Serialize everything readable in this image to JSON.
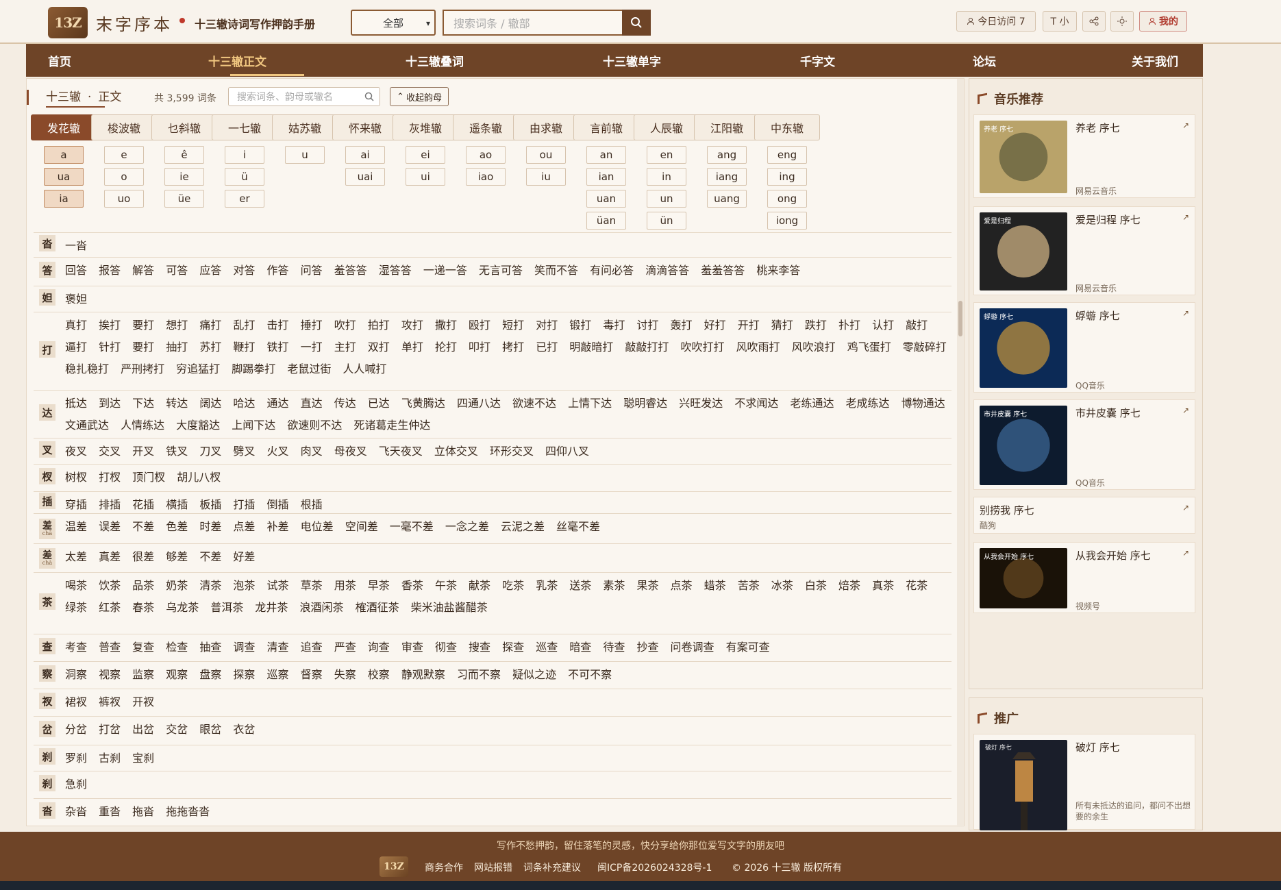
{
  "header": {
    "logo_text": "13Z",
    "brand": "末字序本",
    "tagline": "十三辙诗词写作押韵手册",
    "select_value": "全部",
    "search_placeholder": "搜索词条 / 辙部",
    "visits_label": "今日访问 7",
    "font_label": "T 小",
    "mine_label": "我的"
  },
  "nav": {
    "items": [
      "首页",
      "十三辙正文",
      "十三辙叠词",
      "十三辙单字",
      "千字文",
      "论坛",
      "关于我们"
    ],
    "active": "十三辙正文"
  },
  "content": {
    "tab_label": "十三辙",
    "tab_sep": "·",
    "tab_sub": "正文",
    "count_text": "共 3,599 词条",
    "search_placeholder": "搜索词条、韵母或辙名",
    "collapse_label": "收起韵母",
    "rhymes": [
      {
        "name": "发花辙",
        "finals": [
          "a",
          "ua",
          "ia"
        ]
      },
      {
        "name": "梭波辙",
        "finals": [
          "e",
          "o",
          "uo"
        ]
      },
      {
        "name": "乜斜辙",
        "finals": [
          "ê",
          "ie",
          "üe"
        ]
      },
      {
        "name": "一七辙",
        "finals": [
          "i",
          "ü",
          "er"
        ]
      },
      {
        "name": "姑苏辙",
        "finals": [
          "u"
        ]
      },
      {
        "name": "怀来辙",
        "finals": [
          "ai",
          "uai"
        ]
      },
      {
        "name": "灰堆辙",
        "finals": [
          "ei",
          "ui"
        ]
      },
      {
        "name": "遥条辙",
        "finals": [
          "ao",
          "iao"
        ]
      },
      {
        "name": "由求辙",
        "finals": [
          "ou",
          "iu"
        ]
      },
      {
        "name": "言前辙",
        "finals": [
          "an",
          "ian",
          "uan",
          "üan"
        ]
      },
      {
        "name": "人辰辙",
        "finals": [
          "en",
          "in",
          "un",
          "ün"
        ]
      },
      {
        "name": "江阳辙",
        "finals": [
          "ang",
          "iang",
          "uang"
        ]
      },
      {
        "name": "中东辙",
        "finals": [
          "eng",
          "ing",
          "ong",
          "iong"
        ]
      }
    ],
    "entries": [
      {
        "char": "沓",
        "pinyin": "",
        "words": "一沓"
      },
      {
        "char": "答",
        "pinyin": "",
        "words": "回答 报答 解答 可答 应答 对答 作答 问答 羞答答 湿答答 一递一答 无言可答 笑而不答 有问必答 滴滴答答 羞羞答答 桃来李答"
      },
      {
        "char": "妲",
        "pinyin": "",
        "words": "褒妲"
      },
      {
        "char": "打",
        "pinyin": "",
        "words": "真打 挨打 要打 想打 痛打 乱打 击打 捶打 吹打 拍打 攻打 撒打 殴打 短打 对打 锻打 毒打 讨打 轰打 好打 开打 猜打 跌打 扑打 认打 敲打 逼打 针打 要打 抽打 苏打 鞭打 铁打 一打 主打 双打 单打 抡打 叩打 拷打 已打 明敲暗打 敲敲打打 吹吹打打 风吹雨打 风吹浪打 鸡飞蛋打 零敲碎打 稳扎稳打 严刑拷打 穷追猛打 脚踢拳打 老鼠过街 人人喊打"
      },
      {
        "char": "达",
        "pinyin": "",
        "words": "抵达 到达 下达 转达 阔达 哈达 通达 直达 传达 已达 飞黄腾达 四通八达 欲速不达 上情下达 聪明睿达 兴旺发达 不求闻达 老练通达 老成练达 博物通达 文通武达 人情练达 大度豁达 上闻下达 欲速则不达 死诸葛走生仲达"
      },
      {
        "char": "叉",
        "pinyin": "",
        "words": "夜叉 交叉 开叉 铁叉 刀叉 劈叉 火叉 肉叉 母夜叉 飞天夜叉 立体交叉 环形交叉 四仰八叉"
      },
      {
        "char": "杈",
        "pinyin": "",
        "words": "树杈 打杈 顶门杈 胡儿八杈"
      },
      {
        "char": "插",
        "pinyin": "",
        "words": "穿插 排插 花插 横插 板插 打插 倒插 根插"
      },
      {
        "char": "差",
        "pinyin": "chā",
        "words": "温差 误差 不差 色差 时差 点差 补差 电位差 空间差 一毫不差 一念之差 云泥之差 丝毫不差"
      },
      {
        "char": "差",
        "pinyin": "chà",
        "words": "太差 真差 很差 够差 不差 好差"
      },
      {
        "char": "茶",
        "pinyin": "",
        "words": "喝茶 饮茶 品茶 奶茶 清茶 泡茶 试茶 草茶 用茶 早茶 香茶 午茶 献茶 吃茶 乳茶 送茶 素茶 果茶 点茶 蜡茶 苦茶 冰茶 白茶 焙茶 真茶 花茶 绿茶 红茶 春茶 乌龙茶 普洱茶 龙井茶 浪酒闲茶 榷酒征茶 柴米油盐酱醋茶"
      },
      {
        "char": "查",
        "pinyin": "",
        "words": "考查 普查 复查 检查 抽查 调查 清查 追查 严查 询查 审查 彻查 搜查 探查 巡查 暗查 待查 抄查 问卷调查 有案可查"
      },
      {
        "char": "察",
        "pinyin": "",
        "words": "洞察 视察 监察 观察 盘察 探察 巡察 督察 失察 校察 静观默察 习而不察 疑似之迹 不可不察"
      },
      {
        "char": "衩",
        "pinyin": "",
        "words": "裙衩 裤衩 开衩"
      },
      {
        "char": "岔",
        "pinyin": "",
        "words": "分岔 打岔 出岔 交岔 眼岔 衣岔"
      },
      {
        "char": "刹",
        "pinyin": "",
        "words": "罗刹 古刹 宝刹"
      },
      {
        "char": "刹",
        "pinyin": "",
        "words": "急刹"
      },
      {
        "char": "沓",
        "pinyin": "",
        "words": "杂沓 重沓 拖沓 拖拖沓沓"
      }
    ]
  },
  "sidebar": {
    "music_title": "音乐推荐",
    "songs": [
      {
        "title": "养老 序七",
        "source": "网易云音乐",
        "art": "养老 序七"
      },
      {
        "title": "爱是归程 序七",
        "source": "网易云音乐",
        "art": "爱是归程"
      },
      {
        "title": "蜉蝣 序七",
        "source": "QQ音乐",
        "art": "蜉蝣 序七"
      },
      {
        "title": "市井皮囊 序七",
        "source": "QQ音乐",
        "art": "市井皮囊 序七"
      },
      {
        "title": "别捞我 序七",
        "source": "酷狗",
        "art": ""
      },
      {
        "title": "从我会开始 序七",
        "source": "视频号",
        "art": "从我会开始 序七"
      }
    ],
    "promo_title": "推广",
    "promo": {
      "title": "破灯 序七",
      "desc": "所有未抵达的追问，都问不出想要的余生",
      "art": "破灯 序七"
    }
  },
  "footer": {
    "slogan": "写作不愁押韵，留住落笔的灵感，快分享给你那位爱写文字的朋友吧",
    "logo_text": "13Z",
    "links": [
      "商务合作",
      "网站报错",
      "词条补充建议"
    ],
    "icp": "闽ICP备2026024328号-1",
    "copyright": "© 2026 十三辙 版权所有"
  },
  "colors": {
    "primary": "#6e4427",
    "accent": "#f1c780",
    "active_tab": "#8a4a2a",
    "bg": "#f4ede3"
  }
}
